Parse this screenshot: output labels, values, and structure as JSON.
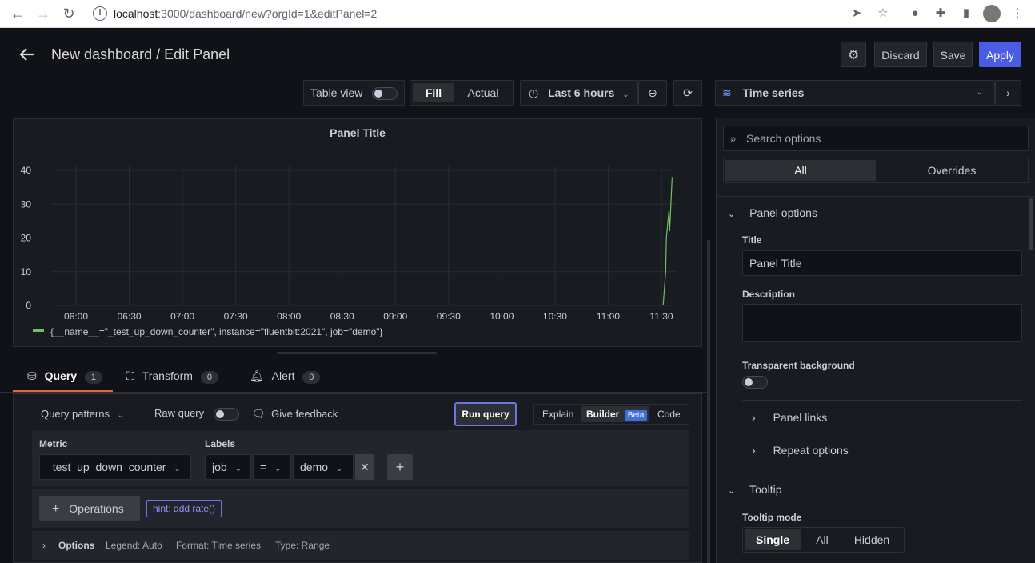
{
  "browser": {
    "url_host": "localhost",
    "url_rest": ":3000/dashboard/new?orgId=1&editPanel=2"
  },
  "header": {
    "title": "New dashboard / Edit Panel",
    "discard_label": "Discard",
    "save_label": "Save",
    "apply_label": "Apply"
  },
  "toolbar": {
    "table_view_label": "Table view",
    "fill_label": "Fill",
    "actual_label": "Actual",
    "time_range_label": "Last 6 hours",
    "visualization_label": "Time series"
  },
  "panel": {
    "title": "Panel Title",
    "legend_label": "{__name__=\"_test_up_down_counter\", instance=\"fluentbit:2021\", job=\"demo\"}"
  },
  "chart_data": {
    "type": "line",
    "title": "Panel Title",
    "xlabel": "",
    "ylabel": "",
    "x_tick_labels": [
      "06:00",
      "06:30",
      "07:00",
      "07:30",
      "08:00",
      "08:30",
      "09:00",
      "09:30",
      "10:00",
      "10:30",
      "11:00",
      "11:30"
    ],
    "y_tick_labels": [
      "0",
      "10",
      "20",
      "30",
      "40"
    ],
    "ylim": [
      0,
      40
    ],
    "grid": true,
    "legend_position": "bottom",
    "series": [
      {
        "name": "{__name__=\"_test_up_down_counter\", instance=\"fluentbit:2021\", job=\"demo\"}",
        "color": "#73bf69",
        "x": [
          "11:31",
          "11:32",
          "11:32",
          "11:33",
          "11:33",
          "11:34"
        ],
        "y": [
          0,
          10,
          20,
          28,
          22,
          38
        ]
      }
    ]
  },
  "tabs": [
    {
      "label": "Query",
      "count": "1"
    },
    {
      "label": "Transform",
      "count": "0"
    },
    {
      "label": "Alert",
      "count": "0"
    }
  ],
  "query": {
    "patterns_label": "Query patterns",
    "raw_query_label": "Raw query",
    "feedback_label": "Give feedback",
    "run_query_label": "Run query",
    "explain_label": "Explain",
    "builder_label": "Builder",
    "beta_label": "Beta",
    "code_label": "Code",
    "metric_label": "Metric",
    "metric_value": "_test_up_down_counter",
    "labels_label": "Labels",
    "label_key": "job",
    "label_op": "=",
    "label_value": "demo",
    "operations_label": "Operations",
    "hint_label": "hint: add rate()",
    "options_label": "Options",
    "legend_info": "Legend: Auto",
    "format_info": "Format: Time series",
    "type_info": "Type: Range"
  },
  "options_pane": {
    "search_placeholder": "Search options",
    "all_label": "All",
    "overrides_label": "Overrides",
    "panel_options_label": "Panel options",
    "title_label": "Title",
    "title_value": "Panel Title",
    "description_label": "Description",
    "transparent_label": "Transparent background",
    "panel_links_label": "Panel links",
    "repeat_options_label": "Repeat options",
    "tooltip_label": "Tooltip",
    "tooltip_mode_label": "Tooltip mode",
    "tooltip_modes": [
      "Single",
      "All",
      "Hidden"
    ]
  },
  "colors": {
    "accent": "#3d71d9",
    "series": "#73bf69",
    "query_tab_underline": "#f55f3e"
  }
}
